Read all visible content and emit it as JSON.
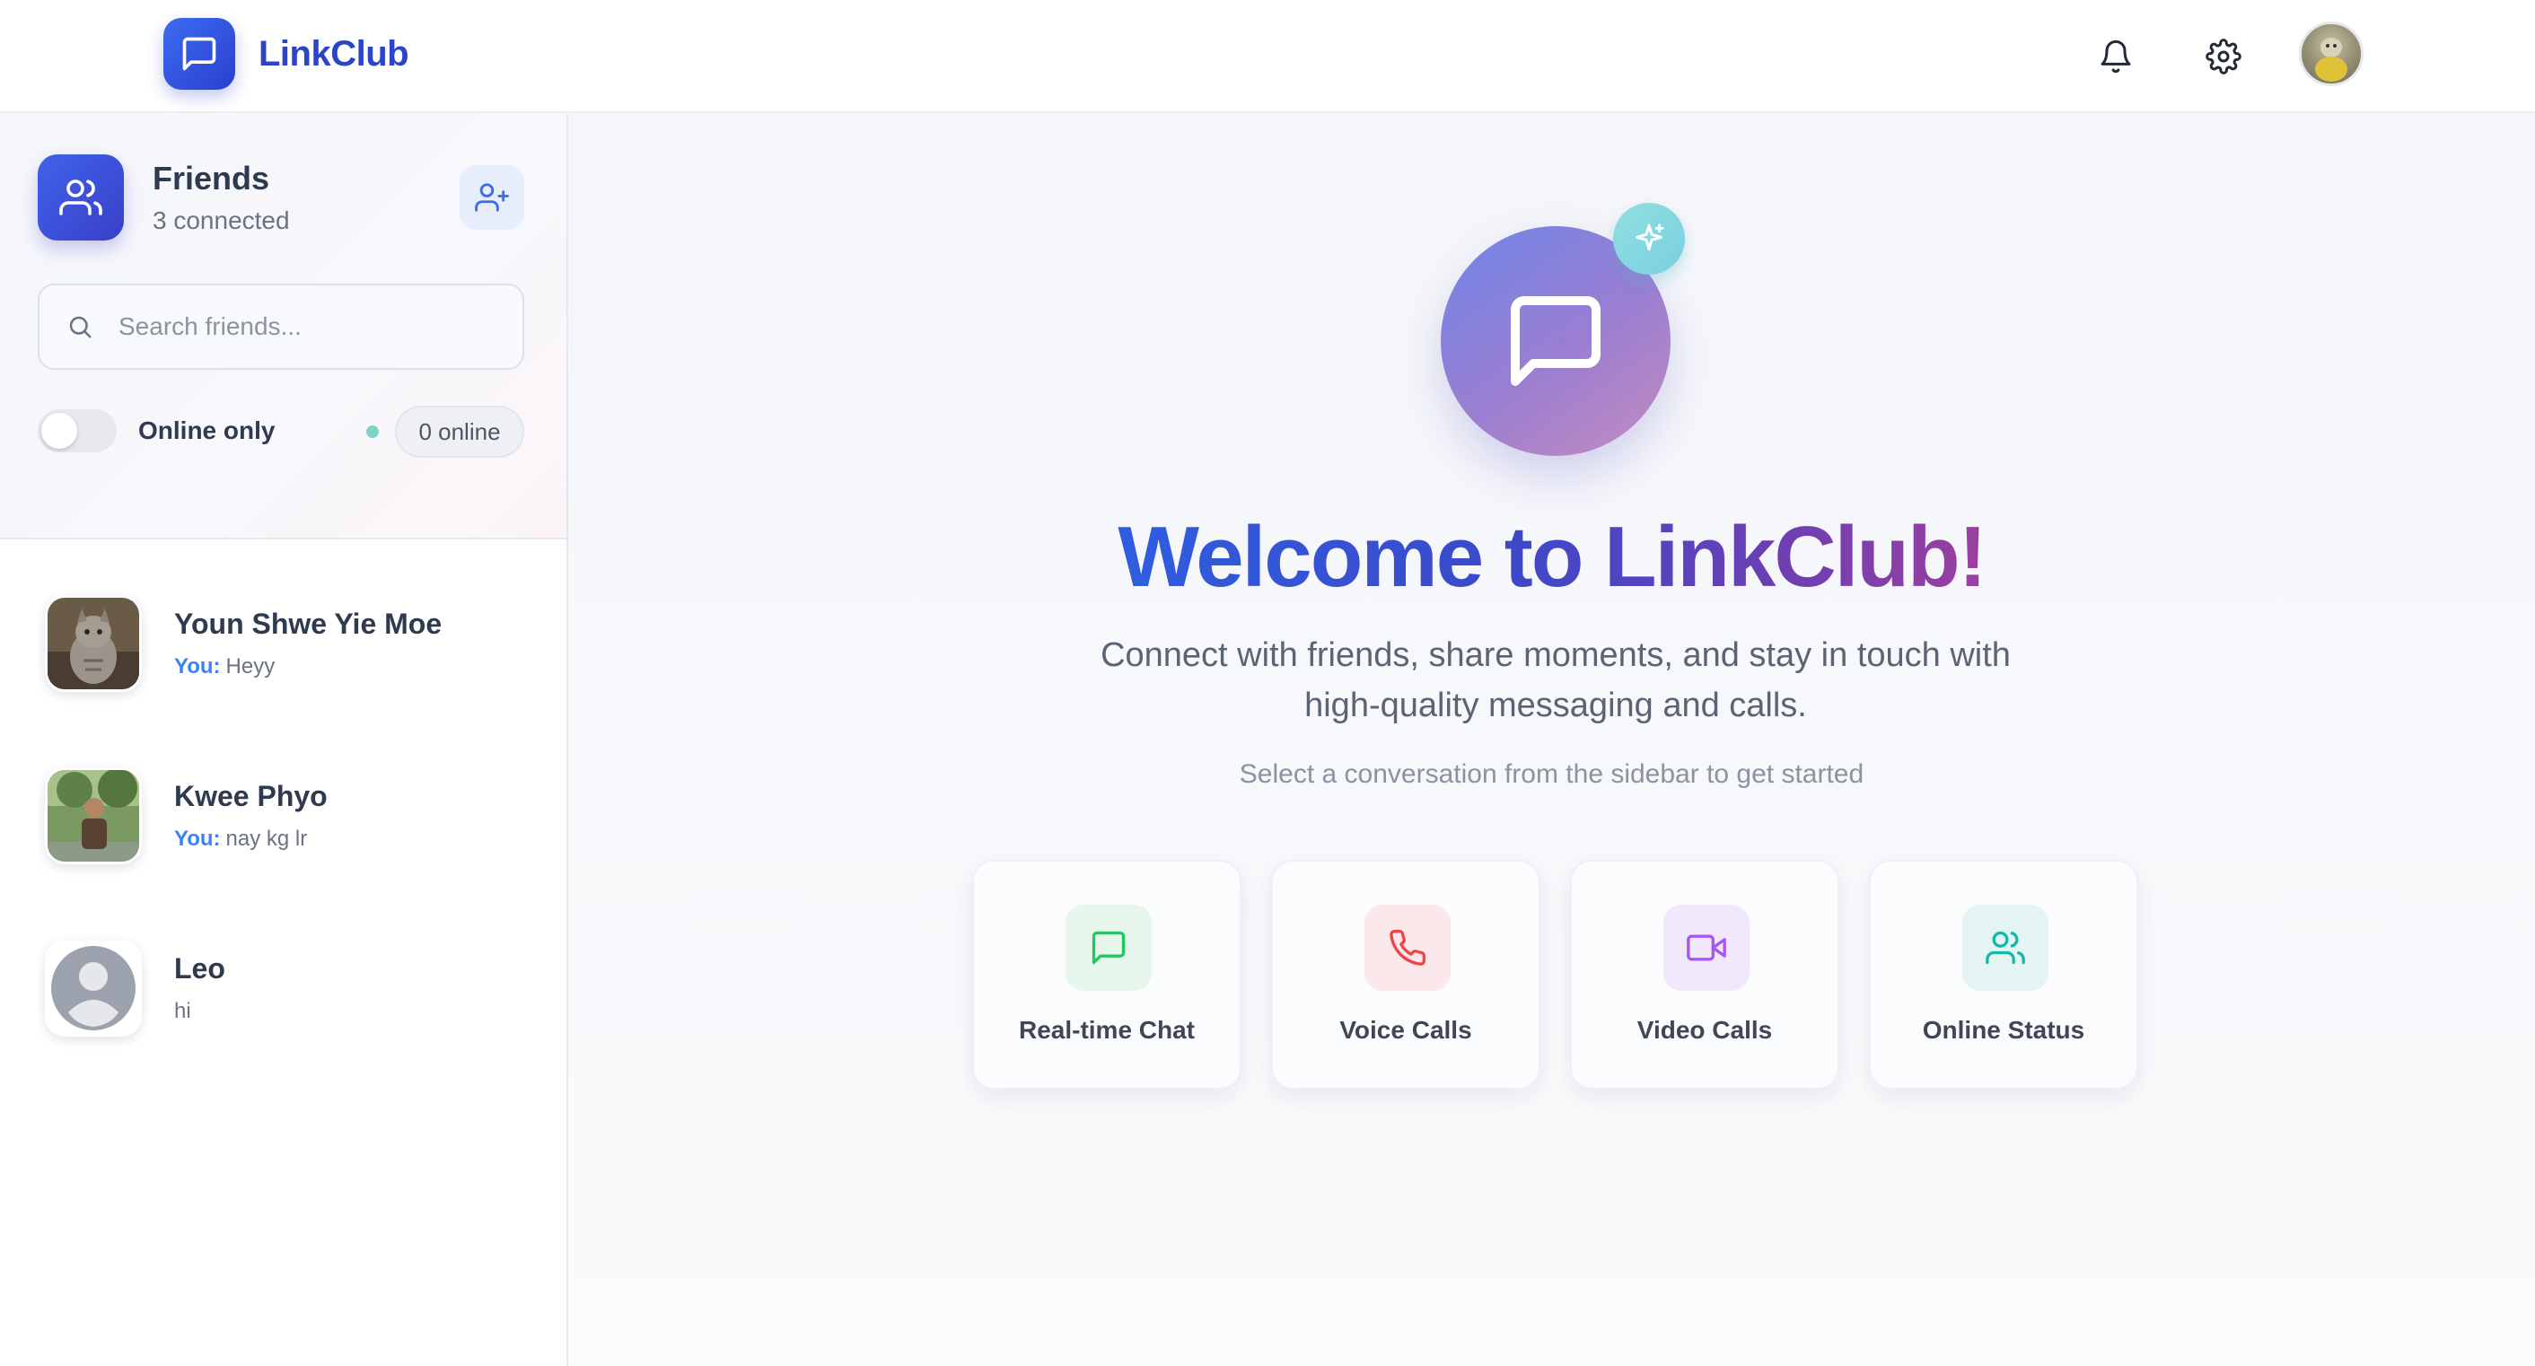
{
  "app": {
    "name": "LinkClub"
  },
  "header": {
    "icons": [
      "bell-icon",
      "gear-icon"
    ],
    "avatar": "user-avatar"
  },
  "sidebar": {
    "title": "Friends",
    "count": "3 connected",
    "search": {
      "placeholder": "Search friends...",
      "value": ""
    },
    "online_toggle": {
      "label": "Online only",
      "on": false
    },
    "online_badge": "0 online",
    "friends": [
      {
        "name": "Youn Shwe Yie Moe",
        "you_prefix": "You:",
        "last": "Heyy",
        "avatar": "cat-photo"
      },
      {
        "name": "Kwee Phyo",
        "you_prefix": "You:",
        "last": "nay kg lr",
        "avatar": "person-photo"
      },
      {
        "name": "Leo",
        "you_prefix": "",
        "last": "hi",
        "avatar": "default-avatar"
      }
    ]
  },
  "main": {
    "title": "Welcome to LinkClub!",
    "subtitle": "Connect with friends, share moments, and stay in touch with high-quality messaging and calls.",
    "hint": "Select a conversation from the sidebar to get started",
    "features": [
      {
        "label": "Real-time Chat",
        "icon": "message-icon",
        "color": "#22c55e",
        "bg": "#e6f6ec"
      },
      {
        "label": "Voice Calls",
        "icon": "phone-icon",
        "color": "#ef4444",
        "bg": "#fbe8ea"
      },
      {
        "label": "Video Calls",
        "icon": "video-icon",
        "color": "#a855f7",
        "bg": "#f1e8fb"
      },
      {
        "label": "Online Status",
        "icon": "users-icon",
        "color": "#14b8a6",
        "bg": "#e3f4f2"
      }
    ]
  },
  "colors": {
    "brand": "#2c44c9",
    "accent_blue": "#3b82f6",
    "online_dot": "#7dd3c5"
  }
}
